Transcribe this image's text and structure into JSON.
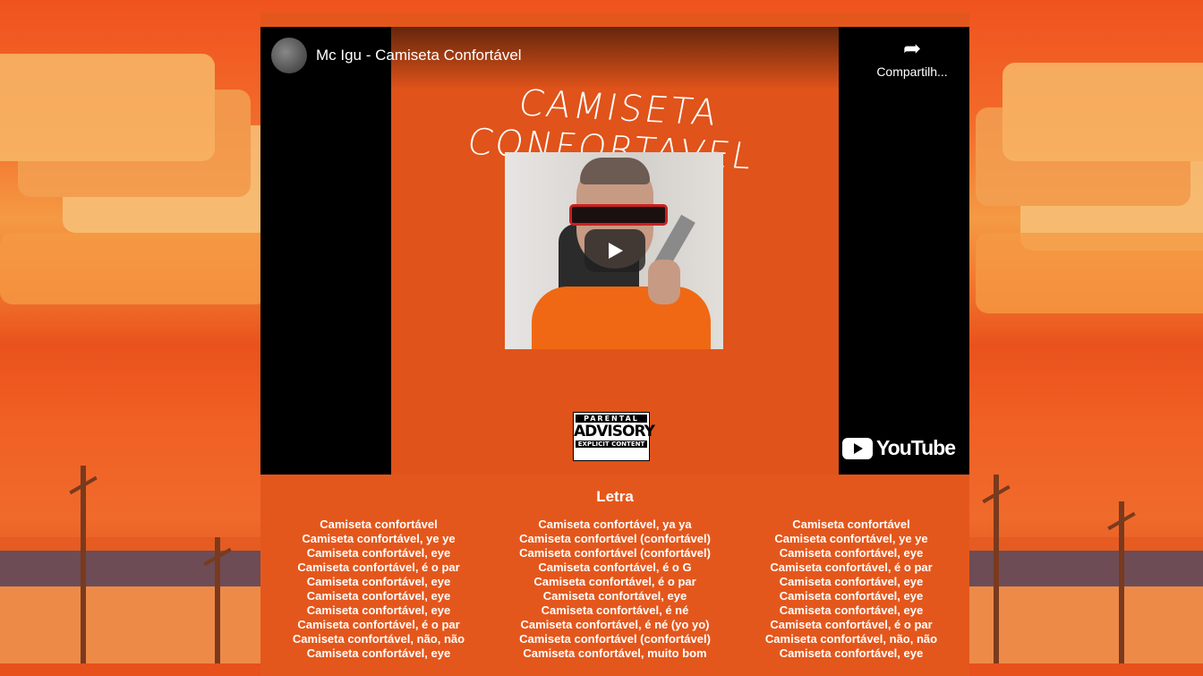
{
  "video": {
    "title": "Mc Igu - Camiseta Confortável",
    "share_label": "Compartilh...",
    "cover_text": "CAMISETA CONFORTAVEL",
    "advisory_top": "PARENTAL",
    "advisory_main": "ADVISORY",
    "advisory_bottom": "EXPLICIT CONTENT",
    "brand": "YouTube"
  },
  "lyrics": {
    "heading": "Letra",
    "columns": [
      [
        "Camiseta confortável",
        "Camiseta confortável, ye ye",
        "Camiseta confortável, eye",
        "Camiseta confortável, é o par",
        "Camiseta confortável, eye",
        "Camiseta confortável, eye",
        "Camiseta confortável, eye",
        "Camiseta confortável, é o par",
        "Camiseta confortável, não, não",
        "Camiseta confortável, eye"
      ],
      [
        "Camiseta confortável, ya ya",
        "Camiseta confortável (confortável)",
        "Camiseta confortável (confortável)",
        "Camiseta confortável, é o G",
        "Camiseta confortável, é o par",
        "Camiseta confortável, eye",
        "Camiseta confortável, é né",
        "Camiseta confortável, é né (yo yo)",
        "Camiseta confortável (confortável)",
        "Camiseta confortável, muito bom"
      ],
      [
        "Camiseta confortável",
        "Camiseta confortável, ye ye",
        "Camiseta confortável, eye",
        "Camiseta confortável, é o par",
        "Camiseta confortável, eye",
        "Camiseta confortável, eye",
        "Camiseta confortável, eye",
        "Camiseta confortável, é o par",
        "Camiseta confortável, não, não",
        "Camiseta confortável, eye"
      ]
    ]
  }
}
